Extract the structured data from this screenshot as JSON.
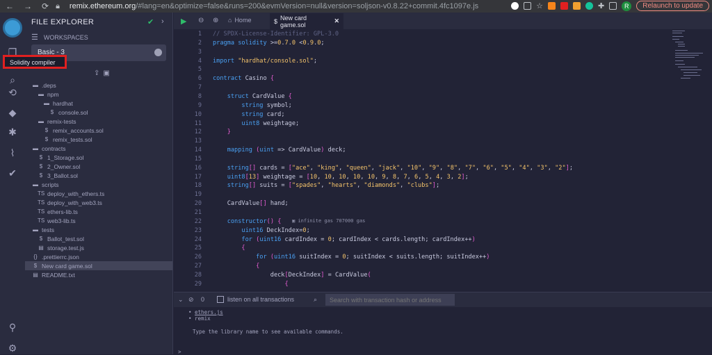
{
  "browser": {
    "url_host": "remix.ethereum.org",
    "url_rest": "/#lang=en&optimize=false&runs=200&evmVersion=null&version=soljson-v0.8.22+commit.4fc1097e.js",
    "profile_initial": "R",
    "relaunch_label": "Relaunch to update"
  },
  "sidebar": {
    "title": "FILE EXPLORER",
    "workspaces_label": "WORKSPACES",
    "workspace_selected": "Basic - 3",
    "tooltip": "Solidity compiler",
    "tree": [
      {
        "label": ".deps",
        "type": "folder",
        "depth": 0
      },
      {
        "label": "npm",
        "type": "folder",
        "depth": 1
      },
      {
        "label": "hardhat",
        "type": "folder",
        "depth": 2
      },
      {
        "label": "console.sol",
        "type": "sol",
        "depth": 3
      },
      {
        "label": "remix-tests",
        "type": "folder",
        "depth": 1
      },
      {
        "label": "remix_accounts.sol",
        "type": "sol",
        "depth": 2
      },
      {
        "label": "remix_tests.sol",
        "type": "sol",
        "depth": 2
      },
      {
        "label": "contracts",
        "type": "folder",
        "depth": 0
      },
      {
        "label": "1_Storage.sol",
        "type": "sol",
        "depth": 1
      },
      {
        "label": "2_Owner.sol",
        "type": "sol",
        "depth": 1
      },
      {
        "label": "3_Ballot.sol",
        "type": "sol",
        "depth": 1
      },
      {
        "label": "scripts",
        "type": "folder",
        "depth": 0
      },
      {
        "label": "deploy_with_ethers.ts",
        "type": "ts",
        "depth": 1
      },
      {
        "label": "deploy_with_web3.ts",
        "type": "ts",
        "depth": 1
      },
      {
        "label": "ethers-lib.ts",
        "type": "ts",
        "depth": 1
      },
      {
        "label": "web3-lib.ts",
        "type": "ts",
        "depth": 1
      },
      {
        "label": "tests",
        "type": "folder",
        "depth": 0
      },
      {
        "label": "Ballot_test.sol",
        "type": "sol",
        "depth": 1
      },
      {
        "label": "storage.test.js",
        "type": "js",
        "depth": 1
      },
      {
        "label": ".prettierrc.json",
        "type": "json",
        "depth": 0
      },
      {
        "label": "New card game.sol",
        "type": "sol",
        "depth": 0,
        "selected": true
      },
      {
        "label": "README.txt",
        "type": "txt",
        "depth": 0
      }
    ]
  },
  "editor": {
    "home_tab": "Home",
    "file_tab": "New card game.sol",
    "gas_hint": "infinite gas 707000 gas",
    "lines": [
      "// SPDX-License-Identifier: GPL-3.0",
      "pragma solidity >=0.7.0 <0.9.0;",
      "",
      "import \"hardhat/console.sol\";",
      "",
      "contract Casino {",
      "",
      "    struct CardValue {",
      "        string symbol;",
      "        string card;",
      "        uint8 weightage;",
      "    }",
      "",
      "    mapping (uint => CardValue) deck;",
      "",
      "    string[] cards = [\"ace\", \"king\", \"queen\", \"jack\", \"10\", \"9\", \"8\", \"7\", \"6\", \"5\", \"4\", \"3\", \"2\"];",
      "    uint8[13] weightage = [10, 10, 10, 10, 10, 9, 8, 7, 6, 5, 4, 3, 2];",
      "    string[] suits = [\"spades\", \"hearts\", \"diamonds\", \"clubs\"];",
      "",
      "    CardValue[] hand;",
      "",
      "    constructor() {",
      "        uint16 DeckIndex=0;",
      "        for (uint16 cardIndex = 0; cardIndex < cards.length; cardIndex++)",
      "        {",
      "            for (uint16 suitIndex = 0; suitIndex < suits.length; suitIndex++)",
      "            {",
      "                deck[DeckIndex] = CardValue(",
      "                    {"
    ]
  },
  "terminal": {
    "count": "0",
    "listen_label": "listen on all transactions",
    "search_placeholder": "Search with transaction hash or address",
    "libs": [
      "ethers.js",
      "remix"
    ],
    "hint": "Type the library name to see available commands.",
    "prompt": ">"
  }
}
